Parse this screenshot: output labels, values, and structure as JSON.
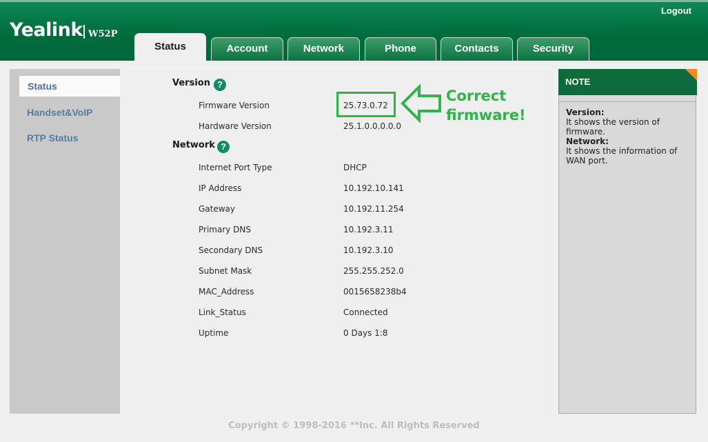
{
  "header": {
    "brand": "Yealink",
    "model": "W52P",
    "logout_label": "Logout"
  },
  "tabs": [
    {
      "label": "Status",
      "active": true
    },
    {
      "label": "Account"
    },
    {
      "label": "Network"
    },
    {
      "label": "Phone"
    },
    {
      "label": "Contacts"
    },
    {
      "label": "Security"
    }
  ],
  "sidebar": {
    "items": [
      {
        "label": "Status",
        "active": true
      },
      {
        "label": "Handset&VoIP"
      },
      {
        "label": "RTP Status"
      }
    ]
  },
  "status": {
    "version": {
      "title": "Version",
      "rows": [
        {
          "label": "Firmware Version",
          "value": "25.73.0.72"
        },
        {
          "label": "Hardware Version",
          "value": "25.1.0.0.0.0.0"
        }
      ]
    },
    "network": {
      "title": "Network",
      "rows": [
        {
          "label": "Internet Port Type",
          "value": "DHCP"
        },
        {
          "label": "IP Address",
          "value": "10.192.10.141"
        },
        {
          "label": "Gateway",
          "value": "10.192.11.254"
        },
        {
          "label": "Primary DNS",
          "value": "10.192.3.11"
        },
        {
          "label": "Secondary DNS",
          "value": "10.192.3.10"
        },
        {
          "label": "Subnet Mask",
          "value": "255.255.252.0"
        },
        {
          "label": "MAC_Address",
          "value": "0015658238b4"
        },
        {
          "label": "Link_Status",
          "value": "Connected"
        },
        {
          "label": "Uptime",
          "value": "0 Days 1:8"
        }
      ]
    },
    "help_icon": "?"
  },
  "annotation": {
    "line1": "Correct",
    "line2": "firmware!",
    "color": "#2fb34a"
  },
  "note": {
    "title": "NOTE",
    "blocks": [
      {
        "heading": "Version:",
        "text": "It shows the version of firmware."
      },
      {
        "heading": "Network:",
        "text": "It shows the information of WAN port."
      }
    ]
  },
  "footer": {
    "copyright": "Copyright © 1998-2016 **Inc. All Rights Reserved"
  },
  "colors": {
    "brand_green": "#006d3d",
    "note_accent": "#f18a21",
    "link_blue": "#567ca3"
  }
}
